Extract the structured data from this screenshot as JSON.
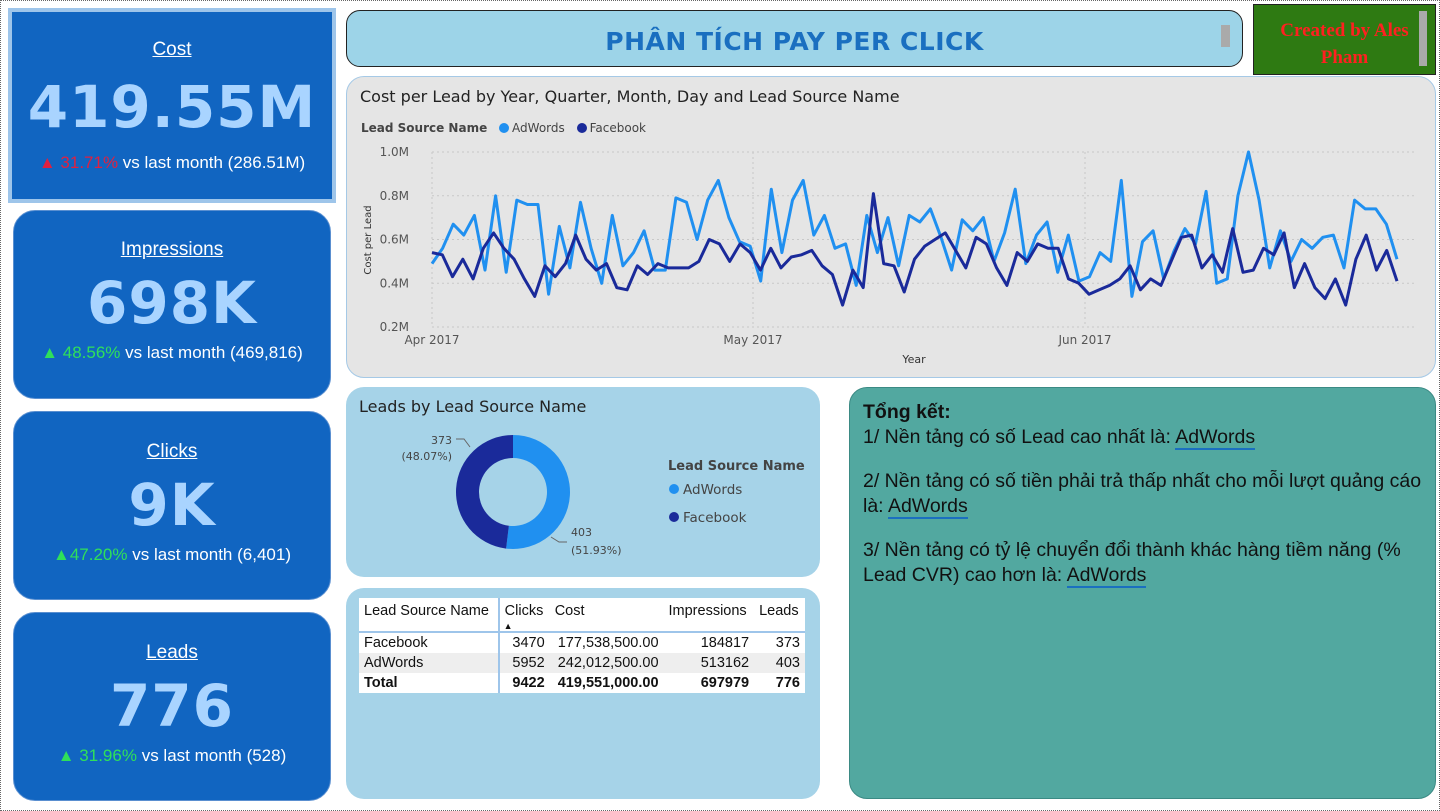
{
  "kpis": [
    {
      "title": "Cost",
      "value": "419.55M",
      "delta": "31.71%",
      "arrow": "▲",
      "rest": " vs last month (286.51M)",
      "color": "#e02040"
    },
    {
      "title": "Impressions",
      "value": "698K",
      "delta": "48.56%",
      "arrow": "▲",
      "rest": " vs last month (469,816)",
      "color": "#2fe05a"
    },
    {
      "title": "Clicks",
      "value": "9K",
      "delta": "47.20%",
      "arrow": "▲",
      "rest": " vs last month (6,401)",
      "color": "#2fe05a"
    },
    {
      "title": "Leads",
      "value": "776",
      "delta": "31.96%",
      "arrow": "▲",
      "rest": " vs last month (528)",
      "color": "#2fe05a"
    }
  ],
  "header": {
    "title": "PHÂN TÍCH PAY PER CLICK",
    "credit_line1": "Created by Ales",
    "credit_line2": "Pham"
  },
  "line_chart": {
    "title": "Cost per Lead by Year, Quarter, Month, Day and Lead Source Name",
    "legend_label": "Lead Source Name",
    "ylabel": "Cost per Lead",
    "xlabel": "Year"
  },
  "donut": {
    "title": "Leads by Lead Source Name",
    "legend_title": "Lead Source Name",
    "facebook_value": "373",
    "facebook_pct": "(48.07%)",
    "adwords_value": "403",
    "adwords_pct": "(51.93%)"
  },
  "table": {
    "headers": [
      "Lead Source Name",
      "Clicks",
      "Cost",
      "Impressions",
      "Leads"
    ],
    "rows": [
      [
        "Facebook",
        "3470",
        "177,538,500.00",
        "184817",
        "373"
      ],
      [
        "AdWords",
        "5952",
        "242,012,500.00",
        "513162",
        "403"
      ],
      [
        "Total",
        "9422",
        "419,551,000.00",
        "697979",
        "776"
      ]
    ]
  },
  "summary": {
    "heading": "Tổng kết:",
    "p1_text": "1/ Nền tảng có số Lead cao nhất là: ",
    "p1_link": "AdWords",
    "p2_text": "2/ Nền tảng có số tiền phải trả thấp nhất cho mỗi lượt quảng cáo là: ",
    "p2_link": "AdWords",
    "p3_text": "3/ Nền tảng có tỷ lệ chuyển đổi thành khác hàng tiềm năng (% Lead CVR) cao hơn là: ",
    "p3_link": "AdWords"
  },
  "chart_data": [
    {
      "type": "line",
      "title": "Cost per Lead by Year, Quarter, Month, Day and Lead Source Name",
      "xlabel": "Year",
      "ylabel": "Cost per Lead",
      "x_ticks": [
        "Apr 2017",
        "May 2017",
        "Jun 2017"
      ],
      "y_ticks": [
        "0.2M",
        "0.4M",
        "0.6M",
        "0.8M",
        "1.0M"
      ],
      "ylim": [
        200000,
        1000000
      ],
      "x_range": [
        "2017-04-01",
        "2017-06-30"
      ],
      "legend_position": "top-left",
      "grid": true,
      "colors": {
        "AdWords": "#2090f0",
        "Facebook": "#1a2a9a"
      },
      "series": [
        {
          "name": "AdWords",
          "values": [
            490000,
            560000,
            670000,
            620000,
            710000,
            460000,
            800000,
            450000,
            780000,
            760000,
            760000,
            350000,
            660000,
            470000,
            770000,
            560000,
            400000,
            710000,
            480000,
            540000,
            640000,
            460000,
            460000,
            790000,
            770000,
            600000,
            780000,
            870000,
            700000,
            590000,
            570000,
            410000,
            830000,
            540000,
            780000,
            870000,
            620000,
            710000,
            560000,
            580000,
            390000,
            710000,
            540000,
            700000,
            480000,
            710000,
            680000,
            740000,
            610000,
            460000,
            690000,
            640000,
            700000,
            500000,
            630000,
            830000,
            490000,
            620000,
            680000,
            450000,
            620000,
            410000,
            430000,
            540000,
            500000,
            870000,
            340000,
            590000,
            640000,
            420000,
            550000,
            650000,
            580000,
            820000,
            400000,
            420000,
            800000,
            1000000,
            780000,
            470000,
            640000,
            500000,
            600000,
            560000,
            610000,
            620000,
            470000,
            780000,
            740000,
            740000,
            670000,
            510000
          ]
        },
        {
          "name": "Facebook",
          "values": [
            540000,
            530000,
            430000,
            510000,
            420000,
            560000,
            630000,
            560000,
            510000,
            420000,
            340000,
            480000,
            430000,
            490000,
            620000,
            510000,
            460000,
            490000,
            380000,
            370000,
            480000,
            440000,
            490000,
            470000,
            470000,
            470000,
            500000,
            600000,
            580000,
            500000,
            580000,
            540000,
            460000,
            560000,
            470000,
            520000,
            530000,
            550000,
            480000,
            440000,
            300000,
            460000,
            380000,
            810000,
            490000,
            480000,
            360000,
            510000,
            570000,
            600000,
            630000,
            550000,
            470000,
            610000,
            580000,
            470000,
            390000,
            540000,
            500000,
            580000,
            560000,
            560000,
            420000,
            400000,
            350000,
            370000,
            390000,
            420000,
            480000,
            370000,
            420000,
            390000,
            500000,
            610000,
            620000,
            470000,
            530000,
            450000,
            650000,
            450000,
            460000,
            560000,
            530000,
            630000,
            380000,
            490000,
            380000,
            330000,
            420000,
            300000,
            510000,
            620000,
            460000,
            550000,
            410000
          ]
        }
      ]
    },
    {
      "type": "pie",
      "title": "Leads by Lead Source Name",
      "categories": [
        "AdWords",
        "Facebook"
      ],
      "values": [
        403,
        373
      ],
      "percents": [
        51.93,
        48.07
      ],
      "colors": [
        "#2090f0",
        "#1a2a9a"
      ],
      "legend_position": "right"
    }
  ]
}
